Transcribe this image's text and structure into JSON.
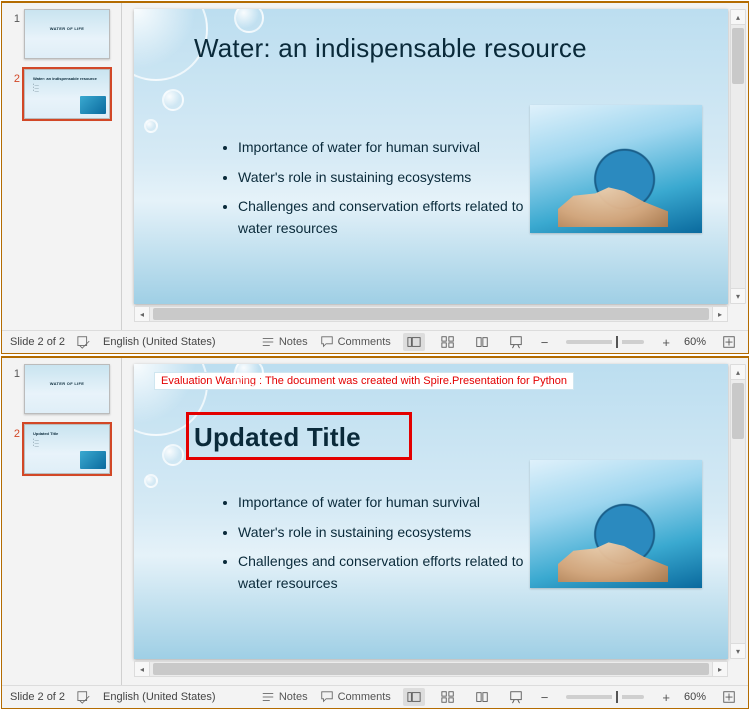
{
  "status": {
    "slide_indicator": "Slide 2 of 2",
    "language": "English (United States)",
    "notes_label": "Notes",
    "comments_label": "Comments",
    "zoom_minus": "−",
    "zoom_plus": "+",
    "zoom_pct": "60%"
  },
  "thumbs": {
    "n1": "1",
    "n2": "2",
    "t1_title": "WATER OF LIFE"
  },
  "pane_top": {
    "slide_title": "Water: an indispensable resource",
    "thumb2_title": "Water: an indispensable resource"
  },
  "pane_bottom": {
    "eval_warning": "Evaluation Warning : The document was created with Spire.Presentation for Python",
    "slide_title": "Updated Title",
    "thumb2_title": "Updated Title"
  },
  "bullets": {
    "b1": "Importance of water for human survival",
    "b2": "Water's role in sustaining ecosystems",
    "b3": "Challenges and conservation efforts related to water resources"
  }
}
